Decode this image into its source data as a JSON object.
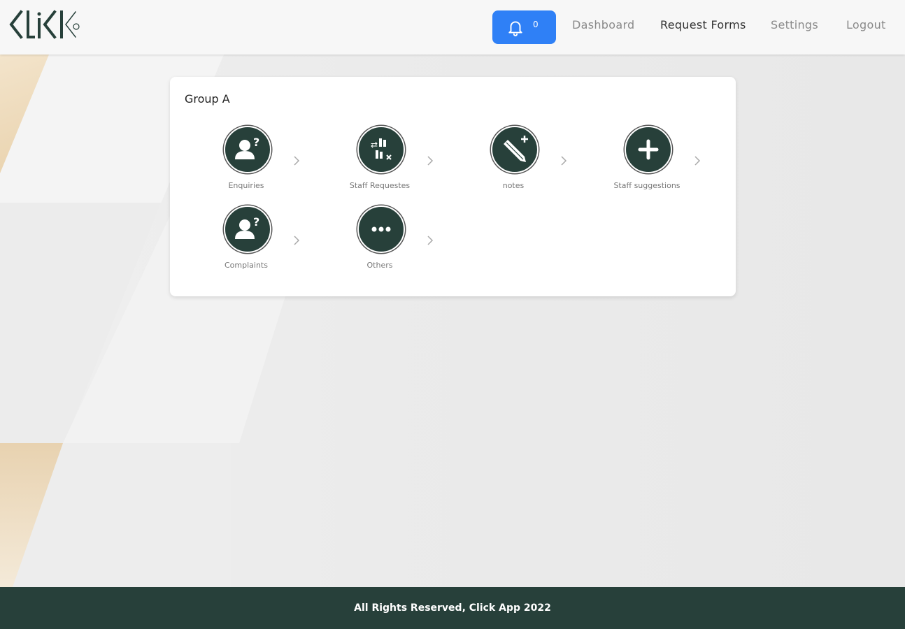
{
  "header": {
    "logo_text": "CLICK",
    "notification_count": "0",
    "nav": [
      {
        "label": "Dashboard"
      },
      {
        "label": "Request Forms"
      },
      {
        "label": "Settings"
      },
      {
        "label": "Logout"
      }
    ]
  },
  "card": {
    "title": "Group A",
    "tiles": [
      {
        "label": "Enquiries",
        "icon": "user-question-icon"
      },
      {
        "label": "Staff Requestes",
        "icon": "staff-request-icon"
      },
      {
        "label": "notes",
        "icon": "pencil-plus-icon"
      },
      {
        "label": "Staff suggestions",
        "icon": "plus-icon"
      },
      {
        "label": "Complaints",
        "icon": "user-question-icon"
      },
      {
        "label": "Others",
        "icon": "ellipsis-icon"
      }
    ]
  },
  "footer": {
    "text": "All Rights Reserved, Click App 2022"
  },
  "colors": {
    "accent": "#2f80f6",
    "brand_dark": "#27403a"
  }
}
